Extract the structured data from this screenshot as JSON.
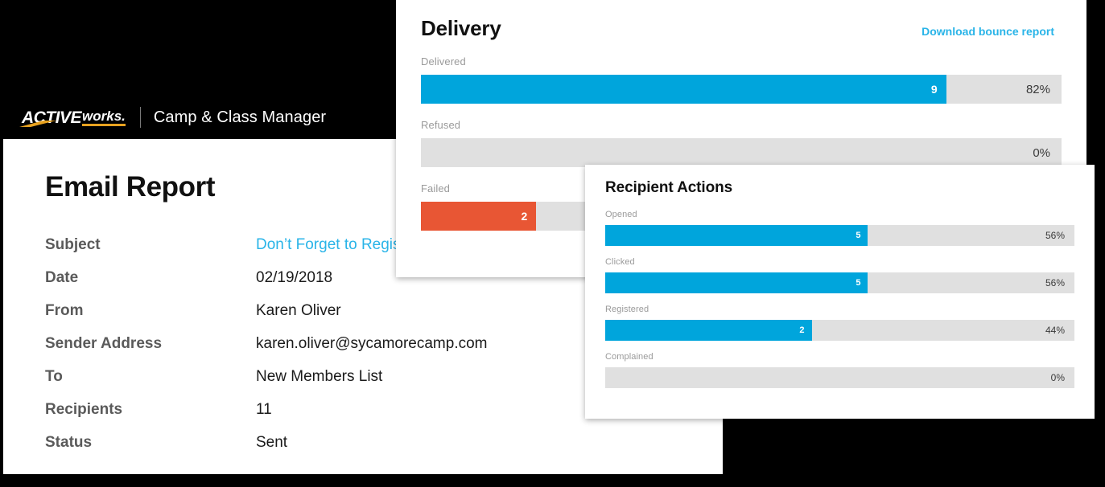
{
  "brand": {
    "logo_primary": "ACTIVE",
    "logo_secondary": "works.",
    "product_name": "Camp & Class Manager",
    "accent_color": "#e8a220"
  },
  "report": {
    "title": "Email Report",
    "rows": [
      {
        "label": "Subject",
        "value": "Don’t Forget to Register",
        "is_link": true
      },
      {
        "label": "Date",
        "value": "02/19/2018"
      },
      {
        "label": "From",
        "value": "Karen Oliver"
      },
      {
        "label": "Sender Address",
        "value": "karen.oliver@sycamorecamp.com"
      },
      {
        "label": "To",
        "value": "New Members List"
      },
      {
        "label": "Recipients",
        "value": "11"
      },
      {
        "label": "Status",
        "value": "Sent"
      }
    ]
  },
  "delivery_card": {
    "title": "Delivery",
    "action_link": "Download bounce report"
  },
  "actions_card": {
    "title": "Recipient Actions"
  },
  "colors": {
    "blue": "#00a5dc",
    "red": "#e85634",
    "track": "#e0e0e0",
    "link": "#29b4e8"
  },
  "chart_data": [
    {
      "type": "bar",
      "title": "Delivery",
      "orientation": "horizontal",
      "categories": [
        "Delivered",
        "Refused",
        "Failed"
      ],
      "values": [
        9,
        0,
        2
      ],
      "percents": [
        82,
        0,
        18
      ],
      "percent_labels": [
        "82%",
        "0%",
        "18%"
      ],
      "count_labels": [
        "9",
        "",
        "2"
      ],
      "bar_colors": [
        "#00a5dc",
        "#e0e0e0",
        "#e85634"
      ],
      "xlabel": "",
      "ylabel": "",
      "xlim": [
        0,
        100
      ],
      "grid": false,
      "legend": false
    },
    {
      "type": "bar",
      "title": "Recipient Actions",
      "orientation": "horizontal",
      "categories": [
        "Opened",
        "Clicked",
        "Registered",
        "Complained"
      ],
      "values": [
        5,
        5,
        2,
        0
      ],
      "percents": [
        56,
        56,
        44,
        0
      ],
      "percent_labels": [
        "56%",
        "56%",
        "44%",
        "0%"
      ],
      "count_labels": [
        "5",
        "5",
        "2",
        ""
      ],
      "bar_colors": [
        "#00a5dc",
        "#00a5dc",
        "#00a5dc",
        "#e0e0e0"
      ],
      "xlabel": "",
      "ylabel": "",
      "xlim": [
        0,
        100
      ],
      "grid": false,
      "legend": false
    }
  ]
}
